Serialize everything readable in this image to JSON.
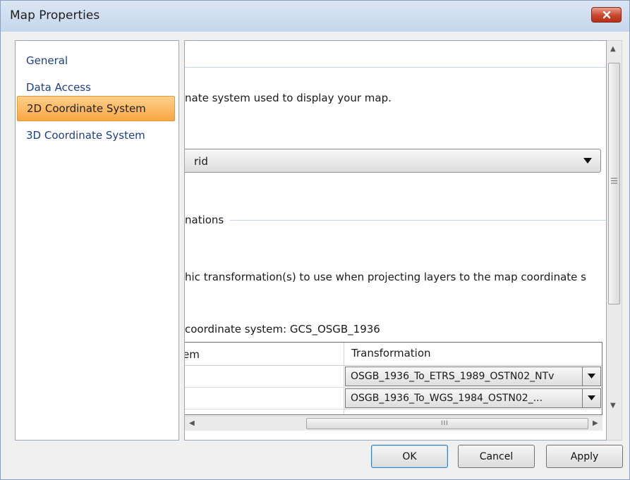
{
  "window": {
    "title": "Map Properties",
    "close_icon": "close-icon"
  },
  "sidebar": {
    "items": [
      {
        "label": "General",
        "active": false
      },
      {
        "label": "Data Access",
        "active": false
      },
      {
        "label": "2D Coordinate System",
        "active": true
      },
      {
        "label": "3D Coordinate System",
        "active": false
      }
    ]
  },
  "content": {
    "description": "nate system used to display your map.",
    "coordinate_system_value": "rid",
    "transformations_section_label": "nations",
    "transformations_description": "hic transformation(s) to use when projecting layers to the map coordinate s",
    "map_gcs_label": " coordinate system: GCS_OSGB_1936",
    "grid": {
      "columns": [
        "em",
        "Transformation"
      ],
      "rows": [
        {
          "system": "",
          "transformation": "OSGB_1936_To_ETRS_1989_OSTN02_NTv"
        },
        {
          "system": "",
          "transformation": "OSGB_1936_To_WGS_1984_OSTN02_..."
        }
      ]
    },
    "hscroll_grip": "III"
  },
  "buttons": {
    "ok": "OK",
    "cancel": "Cancel",
    "apply": "Apply"
  },
  "colors": {
    "active_nav": "#f7a644",
    "link_text": "#1e3f8a",
    "close_button": "#c7442b"
  }
}
